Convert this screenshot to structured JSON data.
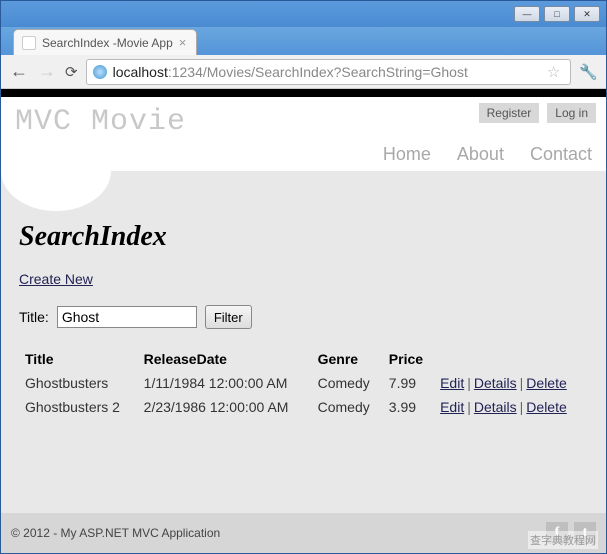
{
  "window": {
    "tab_title": "SearchIndex -Movie App",
    "min_glyph": "—",
    "max_glyph": "□",
    "close_glyph": "✕"
  },
  "address": {
    "host": "localhost",
    "rest": ":1234/Movies/SearchIndex?SearchString=Ghost"
  },
  "brand": "MVC Movie",
  "account": {
    "register": "Register",
    "login": "Log in"
  },
  "nav": {
    "home": "Home",
    "about": "About",
    "contact": "Contact"
  },
  "page": {
    "title": "SearchIndex",
    "create_new": "Create New",
    "search_label": "Title:",
    "search_value": "Ghost",
    "filter_label": "Filter"
  },
  "table": {
    "headers": {
      "title": "Title",
      "release": "ReleaseDate",
      "genre": "Genre",
      "price": "Price"
    },
    "rows": [
      {
        "title": "Ghostbusters",
        "release": "1/11/1984 12:00:00 AM",
        "genre": "Comedy",
        "price": "7.99"
      },
      {
        "title": "Ghostbusters 2",
        "release": "2/23/1986 12:00:00 AM",
        "genre": "Comedy",
        "price": "3.99"
      }
    ],
    "actions": {
      "edit": "Edit",
      "details": "Details",
      "delete": "Delete"
    }
  },
  "footer": {
    "copyright": "© 2012 - My ASP.NET MVC Application"
  },
  "watermark": "查字典教程网"
}
